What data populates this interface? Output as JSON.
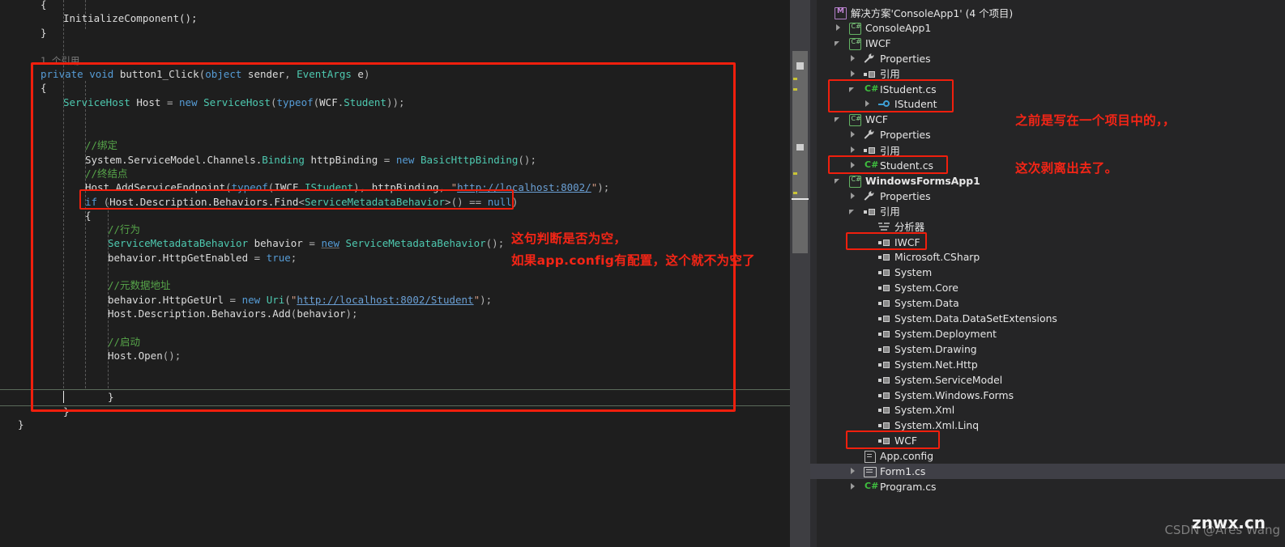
{
  "app": {
    "theme_background": "#1e1e1e",
    "panel_background": "#252526",
    "annotation_color": "#f42516",
    "selection_color": "#3f3f46"
  },
  "editor": {
    "codelens": "1 个引用",
    "lines": [
      {
        "indent": 8,
        "text": "{"
      },
      {
        "indent": 12,
        "text": "InitializeComponent();"
      },
      {
        "indent": 8,
        "text": "}"
      },
      {
        "indent": 0,
        "text": ""
      },
      {
        "indent": 8,
        "text": "1 个引用"
      },
      {
        "indent": 8,
        "text": "private void button1_Click(object sender, EventArgs e)"
      },
      {
        "indent": 8,
        "text": "{"
      },
      {
        "indent": 12,
        "text": "ServiceHost Host = new ServiceHost(typeof(WCF.Student));"
      },
      {
        "indent": 0,
        "text": ""
      },
      {
        "indent": 16,
        "text": "//绑定"
      },
      {
        "indent": 16,
        "text": "System.ServiceModel.Channels.Binding httpBinding = new BasicHttpBinding();"
      },
      {
        "indent": 16,
        "text": "//终结点"
      },
      {
        "indent": 16,
        "text": "Host.AddServiceEndpoint(typeof(IWCF.IStudent), httpBinding, \"http://localhost:8002/\");"
      },
      {
        "indent": 16,
        "text": "if (Host.Description.Behaviors.Find<ServiceMetadataBehavior>() == null)"
      },
      {
        "indent": 16,
        "text": "{"
      },
      {
        "indent": 20,
        "text": "//行为"
      },
      {
        "indent": 20,
        "text": "ServiceMetadataBehavior behavior = new ServiceMetadataBehavior();"
      },
      {
        "indent": 20,
        "text": "behavior.HttpGetEnabled = true;"
      },
      {
        "indent": 0,
        "text": ""
      },
      {
        "indent": 20,
        "text": "//元数据地址"
      },
      {
        "indent": 20,
        "text": "behavior.HttpGetUrl = new Uri(\"http://localhost:8002/Student\");"
      },
      {
        "indent": 20,
        "text": "Host.Description.Behaviors.Add(behavior);"
      },
      {
        "indent": 0,
        "text": ""
      },
      {
        "indent": 20,
        "text": "//启动"
      },
      {
        "indent": 20,
        "text": "Host.Open();"
      },
      {
        "indent": 16,
        "text": "}"
      },
      {
        "indent": 8,
        "text": "}"
      },
      {
        "indent": 4,
        "text": "}"
      }
    ],
    "urls": [
      "http://localhost:8002/",
      "http://localhost:8002/Student"
    ],
    "annotations": [
      {
        "name": "null-check-note-line1",
        "text": "这句判断是否为空，"
      },
      {
        "name": "null-check-note-line2",
        "text": "如果app.config有配置，这个就不为空了"
      }
    ]
  },
  "solution_explorer": {
    "tree": [
      {
        "label": "解决方案'ConsoleApp1' (4 个项目)",
        "depth": 0,
        "arrow": "none",
        "icon": "solution-icon",
        "bold": false,
        "selected": false,
        "boxed": false
      },
      {
        "label": "ConsoleApp1",
        "depth": 1,
        "arrow": "collapsed",
        "icon": "csharp-project-icon",
        "bold": false,
        "selected": false,
        "boxed": false
      },
      {
        "label": "IWCF",
        "depth": 1,
        "arrow": "expanded",
        "icon": "csharp-project-icon",
        "bold": false,
        "selected": false,
        "boxed": false
      },
      {
        "label": "Properties",
        "depth": 2,
        "arrow": "collapsed",
        "icon": "properties-wrench-icon",
        "bold": false,
        "selected": false,
        "boxed": false
      },
      {
        "label": "引用",
        "depth": 2,
        "arrow": "collapsed",
        "icon": "references-icon",
        "bold": false,
        "selected": false,
        "boxed": false
      },
      {
        "label": "IStudent.cs",
        "depth": 2,
        "arrow": "expanded",
        "icon": "csharp-file-icon",
        "bold": false,
        "selected": false,
        "boxed": true
      },
      {
        "label": "IStudent",
        "depth": 3,
        "arrow": "collapsed",
        "icon": "interface-icon",
        "bold": false,
        "selected": false,
        "boxed": true
      },
      {
        "label": "WCF",
        "depth": 1,
        "arrow": "expanded",
        "icon": "csharp-project-icon",
        "bold": false,
        "selected": false,
        "boxed": false
      },
      {
        "label": "Properties",
        "depth": 2,
        "arrow": "collapsed",
        "icon": "properties-wrench-icon",
        "bold": false,
        "selected": false,
        "boxed": false
      },
      {
        "label": "引用",
        "depth": 2,
        "arrow": "collapsed",
        "icon": "references-icon",
        "bold": false,
        "selected": false,
        "boxed": false
      },
      {
        "label": "Student.cs",
        "depth": 2,
        "arrow": "collapsed",
        "icon": "csharp-file-icon",
        "bold": false,
        "selected": false,
        "boxed": true
      },
      {
        "label": "WindowsFormsApp1",
        "depth": 1,
        "arrow": "expanded",
        "icon": "csharp-project-icon",
        "bold": true,
        "selected": false,
        "boxed": false
      },
      {
        "label": "Properties",
        "depth": 2,
        "arrow": "collapsed",
        "icon": "properties-wrench-icon",
        "bold": false,
        "selected": false,
        "boxed": false
      },
      {
        "label": "引用",
        "depth": 2,
        "arrow": "expanded",
        "icon": "references-icon",
        "bold": false,
        "selected": false,
        "boxed": false
      },
      {
        "label": "分析器",
        "depth": 3,
        "arrow": "none",
        "icon": "analyzer-icon",
        "bold": false,
        "selected": false,
        "boxed": false
      },
      {
        "label": "IWCF",
        "depth": 3,
        "arrow": "none",
        "icon": "reference-item-icon",
        "bold": false,
        "selected": false,
        "boxed": true
      },
      {
        "label": "Microsoft.CSharp",
        "depth": 3,
        "arrow": "none",
        "icon": "reference-item-icon",
        "bold": false,
        "selected": false,
        "boxed": false
      },
      {
        "label": "System",
        "depth": 3,
        "arrow": "none",
        "icon": "reference-item-icon",
        "bold": false,
        "selected": false,
        "boxed": false
      },
      {
        "label": "System.Core",
        "depth": 3,
        "arrow": "none",
        "icon": "reference-item-icon",
        "bold": false,
        "selected": false,
        "boxed": false
      },
      {
        "label": "System.Data",
        "depth": 3,
        "arrow": "none",
        "icon": "reference-item-icon",
        "bold": false,
        "selected": false,
        "boxed": false
      },
      {
        "label": "System.Data.DataSetExtensions",
        "depth": 3,
        "arrow": "none",
        "icon": "reference-item-icon",
        "bold": false,
        "selected": false,
        "boxed": false
      },
      {
        "label": "System.Deployment",
        "depth": 3,
        "arrow": "none",
        "icon": "reference-item-icon",
        "bold": false,
        "selected": false,
        "boxed": false
      },
      {
        "label": "System.Drawing",
        "depth": 3,
        "arrow": "none",
        "icon": "reference-item-icon",
        "bold": false,
        "selected": false,
        "boxed": false
      },
      {
        "label": "System.Net.Http",
        "depth": 3,
        "arrow": "none",
        "icon": "reference-item-icon",
        "bold": false,
        "selected": false,
        "boxed": false
      },
      {
        "label": "System.ServiceModel",
        "depth": 3,
        "arrow": "none",
        "icon": "reference-item-icon",
        "bold": false,
        "selected": false,
        "boxed": false
      },
      {
        "label": "System.Windows.Forms",
        "depth": 3,
        "arrow": "none",
        "icon": "reference-item-icon",
        "bold": false,
        "selected": false,
        "boxed": false
      },
      {
        "label": "System.Xml",
        "depth": 3,
        "arrow": "none",
        "icon": "reference-item-icon",
        "bold": false,
        "selected": false,
        "boxed": false
      },
      {
        "label": "System.Xml.Linq",
        "depth": 3,
        "arrow": "none",
        "icon": "reference-item-icon",
        "bold": false,
        "selected": false,
        "boxed": false
      },
      {
        "label": "WCF",
        "depth": 3,
        "arrow": "none",
        "icon": "reference-item-icon",
        "bold": false,
        "selected": false,
        "boxed": true
      },
      {
        "label": "App.config",
        "depth": 2,
        "arrow": "none",
        "icon": "config-file-icon",
        "bold": false,
        "selected": false,
        "boxed": false
      },
      {
        "label": "Form1.cs",
        "depth": 2,
        "arrow": "collapsed",
        "icon": "form-file-icon",
        "bold": false,
        "selected": true,
        "boxed": false
      },
      {
        "label": "Program.cs",
        "depth": 2,
        "arrow": "collapsed",
        "icon": "csharp-file-icon",
        "bold": false,
        "selected": false,
        "boxed": false
      }
    ],
    "annotations": [
      {
        "name": "split-project-note-line1",
        "text": "之前是写在一个项目中的，，"
      },
      {
        "name": "split-project-note-line2",
        "text": "这次剥离出去了。"
      }
    ]
  },
  "watermark": {
    "site": "znwx.cn",
    "credit": "CSDN @Ares Wang"
  }
}
